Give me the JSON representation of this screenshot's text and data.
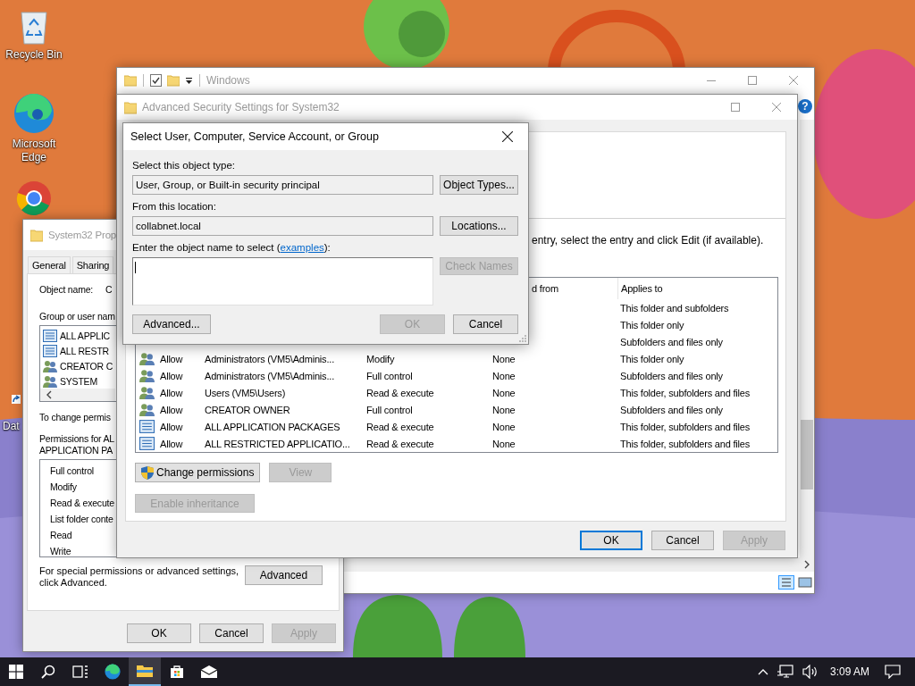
{
  "desktop_icons": [
    {
      "kind": "recycle",
      "label": "Recycle Bin"
    },
    {
      "kind": "edge",
      "label": "Microsoft Edge"
    },
    {
      "kind": "chrome"
    },
    {
      "kind": "shortcut",
      "label": "Dat"
    }
  ],
  "explorer": {
    "title": "Windows",
    "help": "?"
  },
  "advanced": {
    "title": "Advanced Security Settings for System32",
    "instruction": "entry, select the entry and click Edit (if available).",
    "columns": [
      "d from",
      "Applies to"
    ],
    "rows": [
      {
        "applies": "This folder and subfolders"
      },
      {
        "applies": "This folder only"
      },
      {
        "applies": "Subfolders and files only"
      },
      {
        "kind": "group",
        "type": "Allow",
        "principal": "Administrators (VM5\\Adminis...",
        "access": "Modify",
        "inherited": "None",
        "applies": "This folder only"
      },
      {
        "kind": "group",
        "type": "Allow",
        "principal": "Administrators (VM5\\Adminis...",
        "access": "Full control",
        "inherited": "None",
        "applies": "Subfolders and files only"
      },
      {
        "kind": "group",
        "type": "Allow",
        "principal": "Users (VM5\\Users)",
        "access": "Read & execute",
        "inherited": "None",
        "applies": "This folder, subfolders and files"
      },
      {
        "kind": "group",
        "type": "Allow",
        "principal": "CREATOR OWNER",
        "access": "Full control",
        "inherited": "None",
        "applies": "Subfolders and files only"
      },
      {
        "kind": "package",
        "type": "Allow",
        "principal": "ALL APPLICATION PACKAGES",
        "access": "Read & execute",
        "inherited": "None",
        "applies": "This folder, subfolders and files"
      },
      {
        "kind": "package",
        "type": "Allow",
        "principal": "ALL RESTRICTED APPLICATIO...",
        "access": "Read & execute",
        "inherited": "None",
        "applies": "This folder, subfolders and files"
      }
    ],
    "row_buttons": [
      {
        "label": "Change permissions",
        "shield": true,
        "disabled": false
      },
      {
        "label": "View",
        "shield": false,
        "disabled": true
      }
    ],
    "inheritance_button": {
      "label": "Enable inheritance",
      "disabled": true
    },
    "buttons": [
      {
        "label": "OK",
        "default": true,
        "disabled": false
      },
      {
        "label": "Cancel",
        "default": false,
        "disabled": false
      },
      {
        "label": "Apply",
        "default": false,
        "disabled": true
      }
    ]
  },
  "properties": {
    "title": "System32 Prop",
    "tabs": [
      {
        "label": "General",
        "selected": false
      },
      {
        "label": "Sharing",
        "selected": false
      }
    ],
    "object_name_label": "Object name:",
    "object_name": "C",
    "group_label": "Group or user nam",
    "principals": [
      {
        "kind": "package",
        "name": "ALL APPLIC"
      },
      {
        "kind": "package",
        "name": "ALL RESTR"
      },
      {
        "kind": "group",
        "name": "CREATOR C"
      },
      {
        "kind": "group",
        "name": "SYSTEM"
      }
    ],
    "change_hint": "To change permis",
    "permissions_label": [
      "Permissions for AL",
      "APPLICATION PA"
    ],
    "permissions": [
      "Full control",
      "Modify",
      "Read & execute",
      "List folder conte",
      "Read",
      "Write"
    ],
    "special_text": "For special permissions or advanced settings, click Advanced.",
    "advanced_button": "Advanced",
    "buttons": [
      {
        "label": "OK",
        "disabled": false
      },
      {
        "label": "Cancel",
        "disabled": false
      },
      {
        "label": "Apply",
        "disabled": true
      }
    ]
  },
  "dialog": {
    "title": "Select User, Computer, Service Account, or Group",
    "object_type_label": "Select this object type:",
    "object_type": "User, Group, or Built-in security principal",
    "object_types_button": "Object Types...",
    "location_label": "From this location:",
    "location": "collabnet.local",
    "locations_button": "Locations...",
    "name_label_before": "Enter the object name to select (",
    "name_label_link": "examples",
    "name_label_after": "):",
    "check_names": {
      "label": "Check Names",
      "disabled": true
    },
    "advanced_button": "Advanced...",
    "buttons": [
      {
        "label": "OK",
        "disabled": true
      },
      {
        "label": "Cancel",
        "disabled": false
      }
    ]
  },
  "taskbar": {
    "apps": [
      {
        "kind": "start",
        "active": false
      },
      {
        "kind": "search",
        "active": false
      },
      {
        "kind": "taskview",
        "active": false
      },
      {
        "kind": "edge",
        "active": false
      },
      {
        "kind": "explorer",
        "active": true
      },
      {
        "kind": "store",
        "active": false
      },
      {
        "kind": "mail",
        "active": false
      }
    ],
    "clock": "3:09 AM"
  }
}
